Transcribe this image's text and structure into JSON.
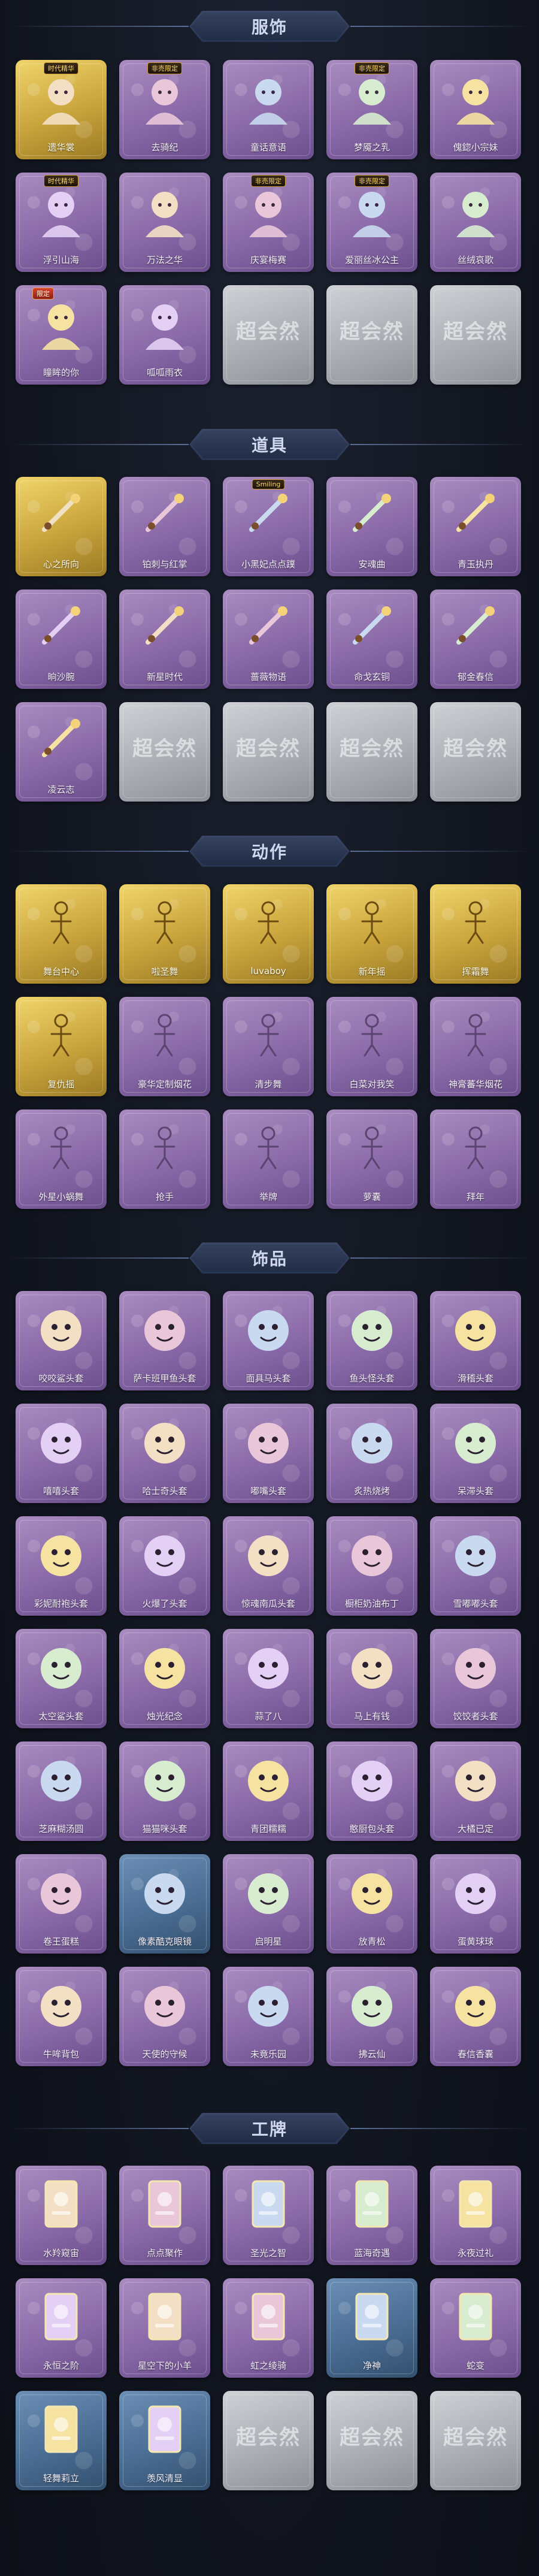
{
  "sections": {
    "clothing": {
      "title": "服饰",
      "items": [
        {
          "name": "遗华裳",
          "style": "gold",
          "tag": "时代精华"
        },
        {
          "name": "去骑纪",
          "style": "purple",
          "tag": "非売限定"
        },
        {
          "name": "童话意语",
          "style": "purple",
          "tag": ""
        },
        {
          "name": "梦魇之乳",
          "style": "purple",
          "tag": "非売限定"
        },
        {
          "name": "傀鍃小宗妹",
          "style": "purple",
          "tag": ""
        },
        {
          "name": "浮引山海",
          "style": "purple",
          "tag": "时代精华"
        },
        {
          "name": "万法之华",
          "style": "purple",
          "tag": ""
        },
        {
          "name": "庆宴梅赛",
          "style": "purple",
          "tag": "非売限定"
        },
        {
          "name": "爱丽丝冰公主",
          "style": "purple",
          "tag": "非売限定"
        },
        {
          "name": "丝绒哀歌",
          "style": "purple",
          "tag": ""
        },
        {
          "name": "瞳眸的你",
          "style": "purple",
          "tag": "限定"
        },
        {
          "name": "呱呱雨衣",
          "style": "purple",
          "tag": ""
        }
      ],
      "empty_count": 3
    },
    "props": {
      "title": "道具",
      "items": [
        {
          "name": "心之所向",
          "style": "gold",
          "tag": ""
        },
        {
          "name": "铂刺与红掌",
          "style": "purple",
          "tag": ""
        },
        {
          "name": "小黑妃点点蹼",
          "style": "purple",
          "tag": "Smiling"
        },
        {
          "name": "安魂曲",
          "style": "purple",
          "tag": ""
        },
        {
          "name": "青玉执丹",
          "style": "purple",
          "tag": ""
        },
        {
          "name": "晌沙腕",
          "style": "purple",
          "tag": ""
        },
        {
          "name": "新星时代",
          "style": "purple",
          "tag": ""
        },
        {
          "name": "蔷薇物语",
          "style": "purple",
          "tag": ""
        },
        {
          "name": "命戈玄铜",
          "style": "purple",
          "tag": ""
        },
        {
          "name": "郁金春信",
          "style": "purple",
          "tag": ""
        },
        {
          "name": "凌云志",
          "style": "purple",
          "tag": ""
        }
      ],
      "empty_count": 4
    },
    "actions": {
      "title": "动作",
      "items": [
        {
          "name": "舞台中心",
          "style": "gold",
          "tag": ""
        },
        {
          "name": "啦圣舞",
          "style": "gold",
          "tag": ""
        },
        {
          "name": "luvaboy",
          "style": "gold",
          "tag": ""
        },
        {
          "name": "新年摇",
          "style": "gold",
          "tag": ""
        },
        {
          "name": "挥霜舞",
          "style": "gold",
          "tag": ""
        },
        {
          "name": "复仇摇",
          "style": "gold",
          "tag": ""
        },
        {
          "name": "豪华定制烟花",
          "style": "purple",
          "tag": ""
        },
        {
          "name": "清步舞",
          "style": "purple",
          "tag": ""
        },
        {
          "name": "白菜对我笑",
          "style": "purple",
          "tag": ""
        },
        {
          "name": "神膏蕃华烟花",
          "style": "purple",
          "tag": ""
        },
        {
          "name": "外星小蜗舞",
          "style": "purple",
          "tag": ""
        },
        {
          "name": "抢手",
          "style": "purple",
          "tag": ""
        },
        {
          "name": "举牌",
          "style": "purple",
          "tag": ""
        },
        {
          "name": "萝囊",
          "style": "purple",
          "tag": ""
        },
        {
          "name": "拜年",
          "style": "purple",
          "tag": ""
        }
      ],
      "empty_count": 0
    },
    "accessories": {
      "title": "饰品",
      "items": [
        {
          "name": "咬咬鲨头套",
          "style": "purple",
          "tag": ""
        },
        {
          "name": "萨卡班甲鱼头套",
          "style": "purple",
          "tag": ""
        },
        {
          "name": "面具马头套",
          "style": "purple",
          "tag": ""
        },
        {
          "name": "鱼头怪头套",
          "style": "purple",
          "tag": ""
        },
        {
          "name": "滑稽头套",
          "style": "purple",
          "tag": ""
        },
        {
          "name": "嘻嘻头套",
          "style": "purple",
          "tag": ""
        },
        {
          "name": "哈士奇头套",
          "style": "purple",
          "tag": ""
        },
        {
          "name": "嘟嘴头套",
          "style": "purple",
          "tag": ""
        },
        {
          "name": "炙热烧烤",
          "style": "purple",
          "tag": ""
        },
        {
          "name": "呆滞头套",
          "style": "purple",
          "tag": ""
        },
        {
          "name": "彩妮耐袍头套",
          "style": "purple",
          "tag": ""
        },
        {
          "name": "火爆了头套",
          "style": "purple",
          "tag": ""
        },
        {
          "name": "惊魂南瓜头套",
          "style": "purple",
          "tag": ""
        },
        {
          "name": "橱柜奶油布丁",
          "style": "purple",
          "tag": ""
        },
        {
          "name": "雪嘟嘟头套",
          "style": "purple",
          "tag": ""
        },
        {
          "name": "太空鲨头套",
          "style": "purple",
          "tag": ""
        },
        {
          "name": "烛光纪念",
          "style": "purple",
          "tag": ""
        },
        {
          "name": "蒜了八",
          "style": "purple",
          "tag": ""
        },
        {
          "name": "马上有钱",
          "style": "purple",
          "tag": ""
        },
        {
          "name": "饺饺者头套",
          "style": "purple",
          "tag": ""
        },
        {
          "name": "芝麻糊汤圆",
          "style": "purple",
          "tag": ""
        },
        {
          "name": "猫猫咪头套",
          "style": "purple",
          "tag": ""
        },
        {
          "name": "青团糯糯",
          "style": "purple",
          "tag": ""
        },
        {
          "name": "憨厨包头套",
          "style": "purple",
          "tag": ""
        },
        {
          "name": "大橘已定",
          "style": "purple",
          "tag": ""
        },
        {
          "name": "卷王蛋糕",
          "style": "purple",
          "tag": ""
        },
        {
          "name": "像素酷克眼镜",
          "style": "blue",
          "tag": ""
        },
        {
          "name": "启明星",
          "style": "purple",
          "tag": ""
        },
        {
          "name": "放青松",
          "style": "purple",
          "tag": ""
        },
        {
          "name": "蛋黄球球",
          "style": "purple",
          "tag": ""
        },
        {
          "name": "牛哞背包",
          "style": "purple",
          "tag": ""
        },
        {
          "name": "天使的守候",
          "style": "purple",
          "tag": ""
        },
        {
          "name": "未竟乐园",
          "style": "purple",
          "tag": ""
        },
        {
          "name": "拂云仙",
          "style": "purple",
          "tag": ""
        },
        {
          "name": "春信香囊",
          "style": "purple",
          "tag": ""
        }
      ],
      "empty_count": 0
    },
    "badges": {
      "title": "工牌",
      "items": [
        {
          "name": "水羚窥宙",
          "style": "purple",
          "tag": ""
        },
        {
          "name": "点点聚作",
          "style": "purple",
          "tag": ""
        },
        {
          "name": "圣光之智",
          "style": "purple",
          "tag": ""
        },
        {
          "name": "蓝海奇遇",
          "style": "purple",
          "tag": ""
        },
        {
          "name": "永夜过礼",
          "style": "purple",
          "tag": ""
        },
        {
          "name": "永恒之阶",
          "style": "purple",
          "tag": ""
        },
        {
          "name": "星空下的小羊",
          "style": "purple",
          "tag": ""
        },
        {
          "name": "虹之绫骑",
          "style": "purple",
          "tag": ""
        },
        {
          "name": "净神",
          "style": "blue",
          "tag": ""
        },
        {
          "name": "蛇变",
          "style": "purple",
          "tag": ""
        },
        {
          "name": "轻舞莉立",
          "style": "blue",
          "tag": ""
        },
        {
          "name": "羡风清显",
          "style": "blue",
          "tag": ""
        }
      ],
      "empty_count": 3
    }
  },
  "empty_card": {
    "watermark": "超会然",
    "subtitle": ""
  }
}
